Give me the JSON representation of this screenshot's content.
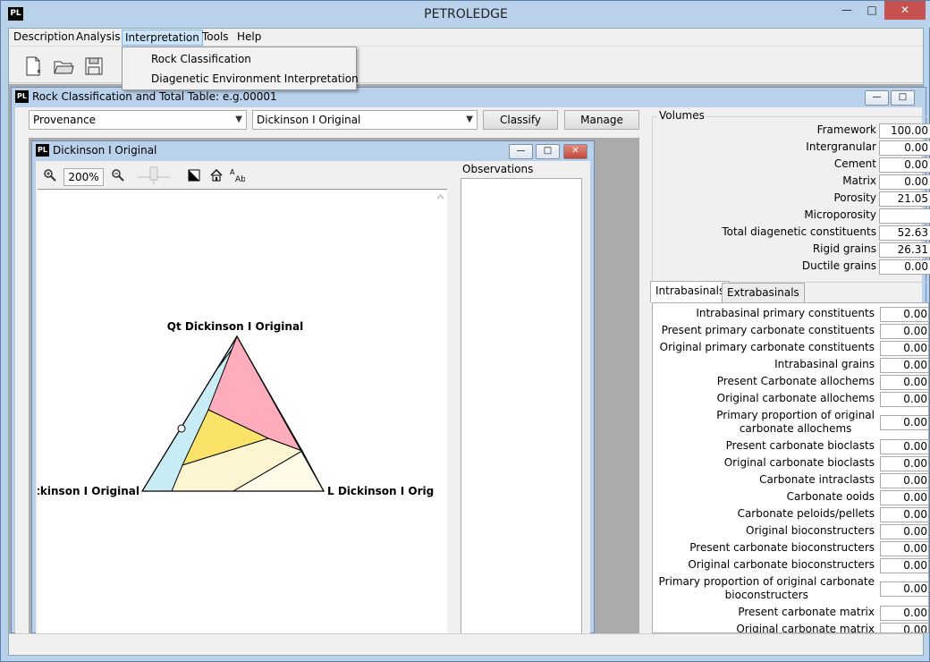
{
  "app": {
    "logo": "PL",
    "title": "PETROLEDGE"
  },
  "window_controls": {
    "minimize": "—",
    "maximize": "□",
    "close": "✕"
  },
  "menu": {
    "items": [
      "Description",
      "Analysis",
      "Interpretation",
      "Tools",
      "Help"
    ],
    "open_index": 2,
    "dropdown": [
      "Rock Classification",
      "Diagenetic Environment Interpretation"
    ]
  },
  "toolbar": {
    "icons": [
      "new-document-icon",
      "open-folder-icon",
      "save-icon"
    ]
  },
  "child_window": {
    "logo": "PL",
    "title": "Rock Classification and Total Table: e.g.00001",
    "provenance_select": "Provenance",
    "diagram_select": "Dickinson I Original",
    "classify_button": "Classify",
    "manage_button": "Manage"
  },
  "diagram_window": {
    "logo": "PL",
    "title": "Dickinson I Original",
    "zoom": "200%",
    "observations_label": "Observations",
    "vertex_top": "Qt Dickinson I Original",
    "vertex_left": "F Dickinson I Original",
    "vertex_right": "L Dickinson I Original",
    "colors": {
      "pink": "#ffadbd",
      "yellow": "#fbe36a",
      "cream": "#fdf5d2",
      "light_cream": "#fffbe8",
      "cyan": "#c8ecf5"
    }
  },
  "volumes": {
    "legend": "Volumes",
    "rows": [
      {
        "label": "Framework",
        "value": "100.00"
      },
      {
        "label": "Intergranular",
        "value": "0.00"
      },
      {
        "label": "Cement",
        "value": "0.00"
      },
      {
        "label": "Matrix",
        "value": "0.00"
      },
      {
        "label": "Porosity",
        "value": "21.05"
      },
      {
        "label": "Microporosity",
        "value": ""
      },
      {
        "label": "Total diagenetic constituents",
        "value": "52.63"
      },
      {
        "label": "Rigid grains",
        "value": "26.31"
      },
      {
        "label": "Ductile grains",
        "value": "0.00"
      }
    ]
  },
  "tabs": {
    "intrabasinals": "Intrabasinals",
    "extrabasinals": "Extrabasinals"
  },
  "intrabasinal_rows": [
    {
      "label": "Intrabasinal primary constituents",
      "value": "0.00"
    },
    {
      "label": "Present primary carbonate constituents",
      "value": "0.00"
    },
    {
      "label": "Original primary carbonate constituents",
      "value": "0.00"
    },
    {
      "label": "Intrabasinal grains",
      "value": "0.00"
    },
    {
      "label": "Present Carbonate allochems",
      "value": "0.00"
    },
    {
      "label": "Original carbonate allochems",
      "value": "0.00"
    },
    {
      "label": "Primary proportion of original\ncarbonate allochems",
      "value": "0.00"
    },
    {
      "label": "Present carbonate bioclasts",
      "value": "0.00"
    },
    {
      "label": "Original carbonate bioclasts",
      "value": "0.00"
    },
    {
      "label": "Carbonate intraclasts",
      "value": "0.00"
    },
    {
      "label": "Carbonate ooids",
      "value": "0.00"
    },
    {
      "label": "Carbonate peloids/pellets",
      "value": "0.00"
    },
    {
      "label": "Original bioconstructers",
      "value": "0.00"
    },
    {
      "label": "Present carbonate bioconstructers",
      "value": "0.00"
    },
    {
      "label": "Original carbonate bioconstructers",
      "value": "0.00"
    },
    {
      "label": "Primary proportion of original carbonate\nbioconstructers",
      "value": "0.00"
    },
    {
      "label": "Present carbonate matrix",
      "value": "0.00"
    },
    {
      "label": "Original carbonate matrix",
      "value": "0.00"
    }
  ]
}
